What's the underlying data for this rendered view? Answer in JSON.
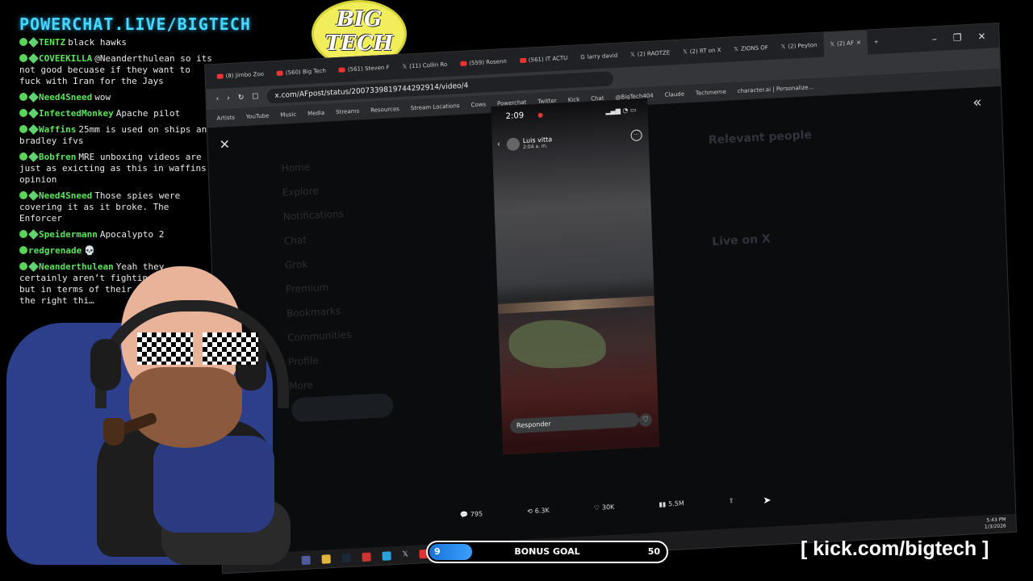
{
  "overlay": {
    "title": "POWERCHAT.LIVE/BIGTECH",
    "logo_line1": "BIG",
    "logo_line2": "TECH",
    "kick_url": "[ kick.com/bigtech ]",
    "accent": "#47d7ff"
  },
  "chat": [
    {
      "user": "TENTZ",
      "text": "black hawks"
    },
    {
      "user": "COVEEKILLA",
      "text": "@Neanderthulean so its not good becuase if they want to fuck with Iran for the Jays"
    },
    {
      "user": "Need4Sneed",
      "text": "wow"
    },
    {
      "user": "InfectedMonkey",
      "text": "Apache pilot"
    },
    {
      "user": "Waffins",
      "text": "25mm is used on ships and bradley ifvs"
    },
    {
      "user": "Bobfren",
      "text": "MRE unboxing videos are just as exicting as this in waffins opinion"
    },
    {
      "user": "Need4Sneed",
      "text": "Those spies were covering it as it broke. The Enforcer"
    },
    {
      "user": "Speidermann",
      "text": "Apocalypto 2"
    },
    {
      "user": "redgrenade",
      "text": ""
    },
    {
      "user": "Neanderthulean",
      "text": "Yeah they certainly aren’t fighting for us, but in terms of their longte… doing the right thi…"
    }
  ],
  "browser": {
    "tabs": [
      "(8) Jimbo Zoo",
      "(560) Big Tech",
      "(561) Steven F",
      "(11) Collin Ro",
      "(559) Rosenn",
      "(561) IT ACTU",
      "larry david",
      "(2) RAOTZE",
      "(2) RT on X",
      "ZIONS OF",
      "(2) Peyton",
      "(2) AF"
    ],
    "url": "x.com/AFpost/status/2007339819744292914/video/4",
    "bookmarks": [
      "Artists",
      "YouTube",
      "Music",
      "Media",
      "Streams",
      "Resources",
      "Stream Locations",
      "Cows",
      "Powerchat",
      "Twitter",
      "Kick",
      "Chat",
      "@BigTech404",
      "Claude",
      "Techmeme",
      "character.ai | Personalize..."
    ]
  },
  "page": {
    "nav": [
      "Home",
      "Explore",
      "Notifications",
      "Chat",
      "Grok",
      "Premium",
      "Bookmarks",
      "Communities",
      "Profile",
      "More"
    ],
    "relevant_title": "Relevant people",
    "live_title": "Live on X"
  },
  "video": {
    "time": "2:09",
    "author": "Luis vitta",
    "posted": "2:04 a. m.",
    "reply_placeholder": "Responder"
  },
  "actions": {
    "replies": "795",
    "reposts": "6.3K",
    "likes": "30K",
    "views": "5.5M"
  },
  "taskbar": {
    "time": "5:43 PM",
    "date": "1/3/2026"
  },
  "goal": {
    "start": "9",
    "label": "BONUS GOAL",
    "end": "50",
    "progress": 0.18
  }
}
